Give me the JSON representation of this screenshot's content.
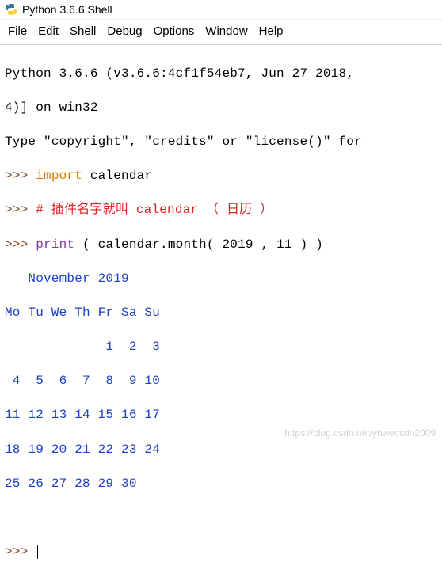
{
  "window": {
    "title": "Python 3.6.6 Shell"
  },
  "menu": {
    "items": [
      "File",
      "Edit",
      "Shell",
      "Debug",
      "Options",
      "Window",
      "Help"
    ]
  },
  "console": {
    "banner1": "Python 3.6.6 (v3.6.6:4cf1f54eb7, Jun 27 2018, ",
    "banner2": "4)] on win32",
    "banner3": "Type \"copyright\", \"credits\" or \"license()\" for",
    "prompt": ">>> ",
    "line1_import": "import",
    "line1_rest": " calendar",
    "line2_comment": "# 插件名字就叫 calendar （ 日历 ）",
    "line3_print": "print",
    "line3_rest": " ( calendar.month( 2019 , 11 ) )",
    "output": {
      "l1": "   November 2019",
      "l2": "Mo Tu We Th Fr Sa Su",
      "l3": "             1  2  3",
      "l4": " 4  5  6  7  8  9 10",
      "l5": "11 12 13 14 15 16 17",
      "l6": "18 19 20 21 22 23 24",
      "l7": "25 26 27 28 29 30"
    }
  },
  "watermark": "https://blog.csdn.net/yhwecsdn2009"
}
